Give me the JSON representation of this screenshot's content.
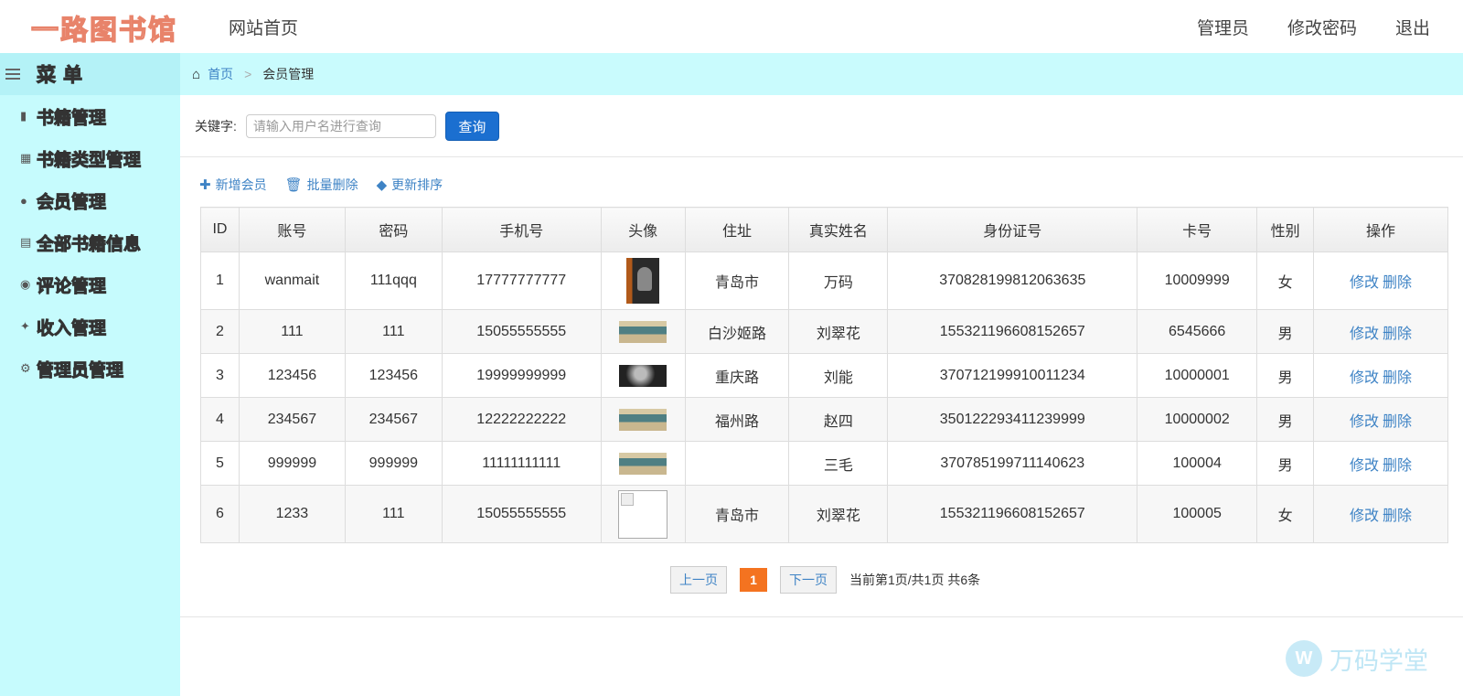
{
  "header": {
    "logo": "一路图书馆",
    "home": "网站首页",
    "right": [
      "管理员",
      "修改密码",
      "退出"
    ]
  },
  "sidebar": {
    "title": "菜单",
    "items": [
      {
        "label": "书籍管理",
        "icon": "book-icon"
      },
      {
        "label": "书籍类型管理",
        "icon": "books-icon"
      },
      {
        "label": "会员管理",
        "icon": "user-icon"
      },
      {
        "label": "全部书籍信息",
        "icon": "newspaper-icon"
      },
      {
        "label": "评论管理",
        "icon": "comment-icon"
      },
      {
        "label": "收入管理",
        "icon": "wrench-icon"
      },
      {
        "label": "管理员管理",
        "icon": "key-icon"
      }
    ]
  },
  "breadcrumb": {
    "home": "首页",
    "current": "会员管理"
  },
  "search": {
    "label": "关键字:",
    "placeholder": "请输入用户名进行查询",
    "value": "",
    "button": "查询"
  },
  "toolbar": {
    "add": "新增会员",
    "batch_delete": "批量删除",
    "update_sort": "更新排序"
  },
  "table": {
    "headers": [
      "ID",
      "账号",
      "密码",
      "手机号",
      "头像",
      "住址",
      "真实姓名",
      "身份证号",
      "卡号",
      "性别",
      "操作"
    ],
    "rows": [
      {
        "id": "1",
        "account": "wanmait",
        "password": "111qqq",
        "phone": "17777777777",
        "avatar": "portrait",
        "address": "青岛市",
        "name": "万码",
        "idcard": "370828199812063635",
        "card": "10009999",
        "gender": "女"
      },
      {
        "id": "2",
        "account": "111",
        "password": "111",
        "phone": "15055555555",
        "avatar": "library",
        "address": "白沙姬路",
        "name": "刘翠花",
        "idcard": "155321196608152657",
        "card": "6545666",
        "gender": "男"
      },
      {
        "id": "3",
        "account": "123456",
        "password": "123456",
        "phone": "19999999999",
        "avatar": "dark",
        "address": "重庆路",
        "name": "刘能",
        "idcard": "370712199910011234",
        "card": "10000001",
        "gender": "男"
      },
      {
        "id": "4",
        "account": "234567",
        "password": "234567",
        "phone": "12222222222",
        "avatar": "library",
        "address": "福州路",
        "name": "赵四",
        "idcard": "350122293411239999",
        "card": "10000002",
        "gender": "男"
      },
      {
        "id": "5",
        "account": "999999",
        "password": "999999",
        "phone": "11111111111",
        "avatar": "library",
        "address": "",
        "name": "三毛",
        "idcard": "370785199711140623",
        "card": "100004",
        "gender": "男"
      },
      {
        "id": "6",
        "account": "1233",
        "password": "111",
        "phone": "15055555555",
        "avatar": "broken",
        "address": "青岛市",
        "name": "刘翠花",
        "idcard": "155321196608152657",
        "card": "100005",
        "gender": "女"
      }
    ],
    "edit_label": "修改",
    "delete_label": "删除"
  },
  "pager": {
    "prev": "上一页",
    "current": "1",
    "next": "下一页",
    "info": "当前第1页/共1页 共6条"
  },
  "watermark": {
    "text": "万码学堂"
  },
  "colors": {
    "sidebar_bg": "#c6fbfd",
    "link": "#3e83c5",
    "primary_button": "#1b6fd0",
    "page_active": "#f47320"
  }
}
